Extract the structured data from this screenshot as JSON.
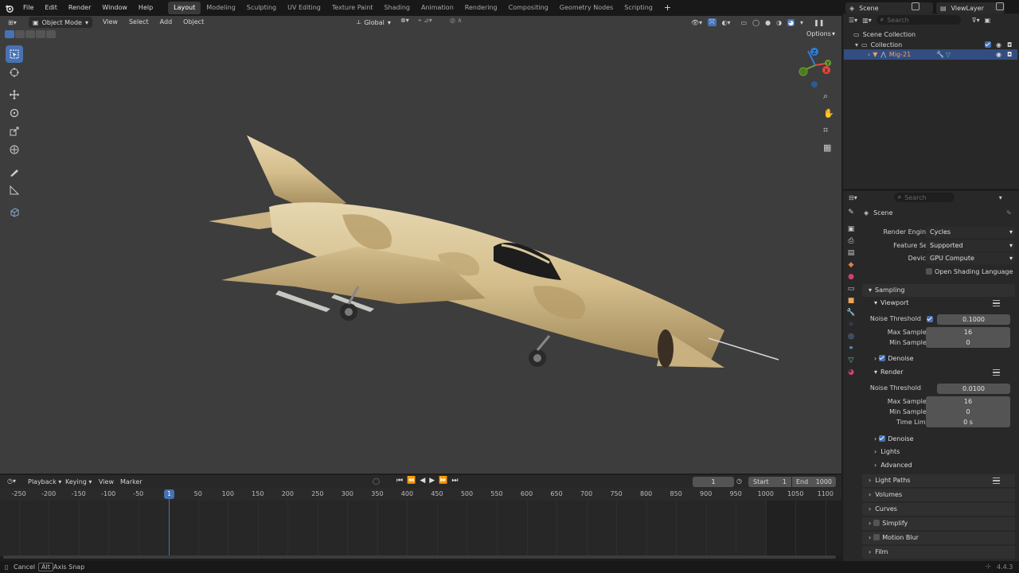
{
  "topbar": {
    "menus": [
      "File",
      "Edit",
      "Render",
      "Window",
      "Help"
    ],
    "workspaces": [
      "Layout",
      "Modeling",
      "Sculpting",
      "UV Editing",
      "Texture Paint",
      "Shading",
      "Animation",
      "Rendering",
      "Compositing",
      "Geometry Nodes",
      "Scripting"
    ],
    "active_workspace": "Layout",
    "scene_name": "Scene",
    "view_layer": "ViewLayer"
  },
  "viewport": {
    "mode": "Object Mode",
    "menus": [
      "View",
      "Select",
      "Add",
      "Object"
    ],
    "orientation": "Global",
    "options_label": "Options",
    "bg_color": "#3d3d3d"
  },
  "outliner": {
    "search_placeholder": "Search",
    "root": "Scene Collection",
    "collection": "Collection",
    "object": "Mig-21"
  },
  "properties": {
    "search_placeholder": "Search",
    "context": "Scene",
    "render_engine_label": "Render Engine",
    "render_engine": "Cycles",
    "feature_set_label": "Feature Set",
    "feature_set": "Supported",
    "device_label": "Device",
    "device": "GPU Compute",
    "osl_label": "Open Shading Language",
    "sampling": "Sampling",
    "viewport_sub": "Viewport",
    "noise_threshold_label": "Noise Threshold",
    "vp_noise": "0.1000",
    "max_samples_label": "Max Samples",
    "vp_max": "16",
    "min_samples_label": "Min Samples",
    "vp_min": "0",
    "denoise_label": "Denoise",
    "render_sub": "Render",
    "r_noise": "0.0100",
    "r_max": "16",
    "r_min": "0",
    "time_limit_label": "Time Limit",
    "r_time": "0 s",
    "lights": "Lights",
    "advanced": "Advanced",
    "light_paths": "Light Paths",
    "volumes": "Volumes",
    "curves": "Curves",
    "simplify": "Simplify",
    "motion_blur": "Motion Blur",
    "film": "Film"
  },
  "timeline": {
    "menus": [
      "Playback",
      "Keying",
      "View",
      "Marker"
    ],
    "current_frame": "1",
    "start_label": "Start",
    "start": "1",
    "end_label": "End",
    "end": "1000",
    "ruler": [
      "-250",
      "-200",
      "-150",
      "-100",
      "-50",
      "1",
      "50",
      "100",
      "150",
      "200",
      "250",
      "300",
      "350",
      "400",
      "450",
      "500",
      "550",
      "600",
      "650",
      "700",
      "750",
      "800",
      "850",
      "900",
      "950",
      "1000",
      "1050",
      "1100"
    ]
  },
  "statusbar": {
    "cancel": "Cancel",
    "alt_key": "Alt",
    "axis_snap": "Axis Snap",
    "version": "4.4.3"
  },
  "colors": {
    "accent": "#4772b3",
    "x_axis": "#e5483f",
    "y_axis": "#6b9e2c",
    "z_axis": "#2f7ed8"
  }
}
